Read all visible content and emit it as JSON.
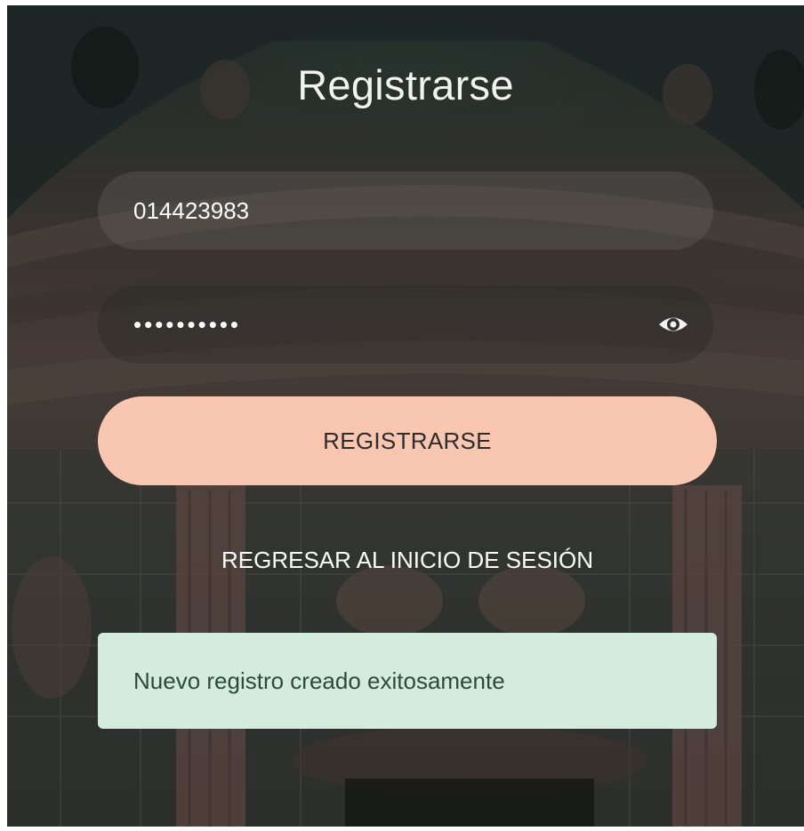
{
  "form": {
    "title": "Registrarse",
    "user_field": {
      "value": "014423983"
    },
    "password_field": {
      "masked_value": "••••••••••"
    },
    "register_button_label": "REGISTRARSE",
    "back_link_label": "REGRESAR AL INICIO DE SESIÓN"
  },
  "alert": {
    "message": "Nuevo registro creado exitosamente"
  },
  "icons": {
    "password_toggle": "eye-icon"
  },
  "colors": {
    "primary_button": "#f9c6b0",
    "alert_background": "#d4ecdb",
    "alert_text": "#2b4b37"
  }
}
